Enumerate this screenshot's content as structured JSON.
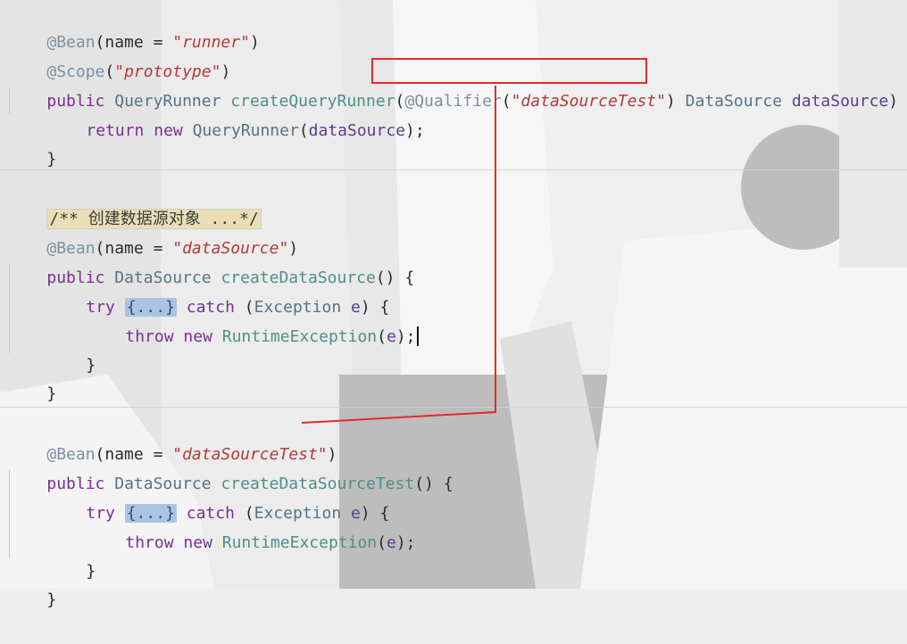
{
  "editor": {
    "lines": [
      {
        "parts": [
          "@Bean",
          "(name = ",
          "\"runner\"",
          ")"
        ]
      },
      {
        "parts": [
          "@Scope",
          "(",
          "\"prototype\"",
          ")"
        ]
      },
      {
        "parts": [
          "public",
          "QueryRunner",
          "createQueryRunner",
          "(",
          "@Qualifier",
          "(",
          "\"dataSourceTest\"",
          ")",
          "DataSource",
          "dataSource",
          ") {"
        ]
      },
      {
        "parts": [
          "return",
          "new",
          "QueryRunner",
          "(",
          "dataSource",
          ");"
        ]
      },
      {
        "parts": [
          "}"
        ]
      },
      {
        "parts": [
          "/** 创建数据源对象 ...*/"
        ]
      },
      {
        "parts": [
          "@Bean",
          "(name = ",
          "\"dataSource\"",
          ")"
        ]
      },
      {
        "parts": [
          "public",
          "DataSource",
          "createDataSource",
          "() {"
        ]
      },
      {
        "parts": [
          "try",
          "{...}",
          "catch",
          "(",
          "Exception",
          "e",
          ") {"
        ]
      },
      {
        "parts": [
          "throw",
          "new",
          "RuntimeException",
          "(",
          "e",
          ");"
        ]
      },
      {
        "parts": [
          "}"
        ]
      },
      {
        "parts": [
          "}"
        ]
      },
      {
        "parts": [
          "@Bean",
          "(name = ",
          "\"dataSourceTest\"",
          ")"
        ]
      },
      {
        "parts": [
          "public",
          "DataSource",
          "createDataSourceTest",
          "() {"
        ]
      },
      {
        "parts": [
          "try",
          "{...}",
          "catch",
          "(",
          "Exception",
          "e",
          ") {"
        ]
      },
      {
        "parts": [
          "throw",
          "new",
          "RuntimeException",
          "(",
          "e",
          ");"
        ]
      },
      {
        "parts": [
          "}"
        ]
      },
      {
        "parts": [
          "}"
        ]
      }
    ]
  },
  "colors": {
    "highlight_box": "#e12b2b",
    "connector_line": "#e12b2b",
    "annotation": "#7d8fa3",
    "keyword": "#7a2e93",
    "string": "#b23a3a"
  }
}
